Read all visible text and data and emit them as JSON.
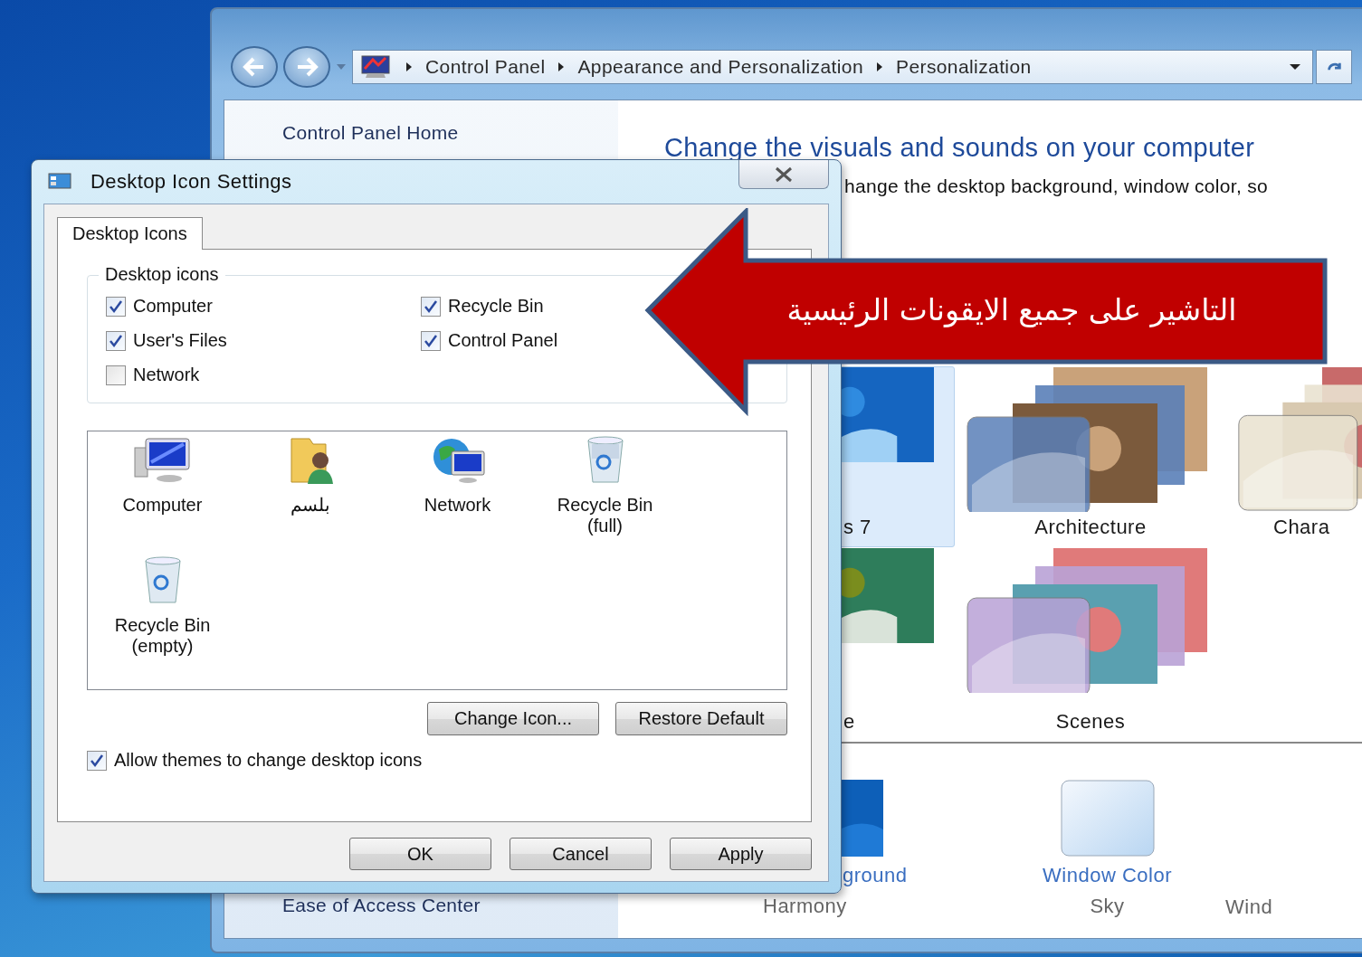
{
  "control_panel": {
    "breadcrumb": [
      "Control Panel",
      "Appearance and Personalization",
      "Personalization"
    ],
    "sidebar": {
      "home_link": "Control Panel Home",
      "bottom_link": "Ease of Access Center"
    },
    "heading": "Change the visuals and sounds on your computer",
    "subheading": "hange the desktop background, window color, so",
    "themes": [
      {
        "label": "s 7",
        "selected": true
      },
      {
        "label": "Architecture",
        "selected": false
      },
      {
        "label": "Chara",
        "selected": false
      },
      {
        "label": "e",
        "selected": false
      },
      {
        "label": "Scenes",
        "selected": false
      }
    ],
    "settings": [
      {
        "label": "ground",
        "value": "Harmony"
      },
      {
        "label": "Window Color",
        "value": "Sky"
      },
      {
        "value": "Wind"
      }
    ]
  },
  "dialog": {
    "title": "Desktop Icon Settings",
    "tabs": [
      {
        "label": "Desktop Icons",
        "selected": true
      }
    ],
    "group_title": "Desktop icons",
    "checkboxes": [
      {
        "label": "Computer",
        "checked": true
      },
      {
        "label": "Recycle Bin",
        "checked": true
      },
      {
        "label": "User's Files",
        "checked": true
      },
      {
        "label": "Control Panel",
        "checked": true
      },
      {
        "label": "Network",
        "checked": false
      }
    ],
    "icons": [
      {
        "label": "Computer",
        "kind": "computer"
      },
      {
        "label": "بلسم",
        "kind": "user"
      },
      {
        "label": "Network",
        "kind": "network"
      },
      {
        "label": "Recycle Bin (full)",
        "kind": "bin_full"
      },
      {
        "label": "Recycle Bin (empty)",
        "kind": "bin_empty"
      }
    ],
    "icon_buttons": [
      "Change Icon...",
      "Restore Default"
    ],
    "allow_themes": {
      "label": "Allow themes to change desktop icons",
      "checked": true
    },
    "buttons": [
      "OK",
      "Cancel",
      "Apply"
    ]
  },
  "callout": {
    "text": "التاشير على جميع الايقونات الرئيسية"
  }
}
